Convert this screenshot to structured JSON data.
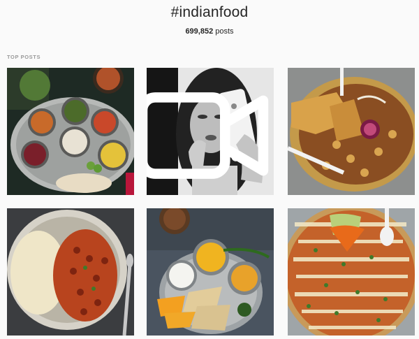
{
  "header": {
    "hashtag": "#indianfood",
    "post_count": "699,852",
    "post_count_suffix": "posts"
  },
  "section": {
    "label": "TOP POSTS"
  },
  "posts": [
    {
      "icon": "thali-plate-image"
    },
    {
      "icon": "makeup-selfie-image",
      "video": true
    },
    {
      "icon": "chaat-papdi-image"
    },
    {
      "icon": "rajma-rice-image"
    },
    {
      "icon": "roti-thali-image"
    },
    {
      "icon": "cheese-pizza-image"
    }
  ]
}
